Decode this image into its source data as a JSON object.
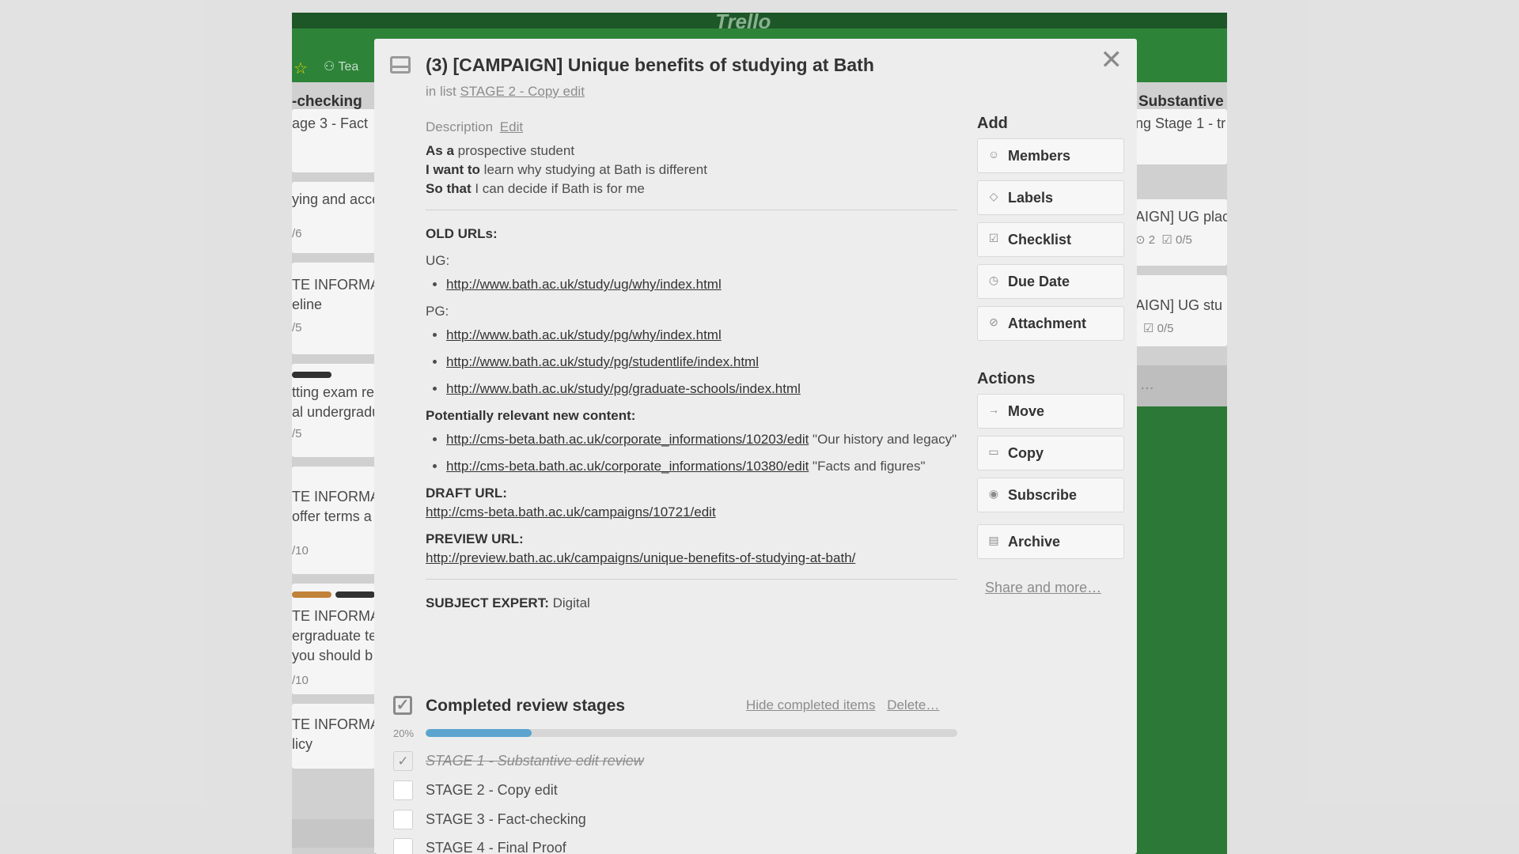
{
  "board": {
    "logo": "Trello",
    "team_label": "Tea",
    "left_list": {
      "title": "-checking",
      "cards": [
        "age 3 - Fact",
        "ying and acce",
        "/6",
        "TE INFORMA",
        "eline",
        "/5",
        "tting exam re",
        "al undergradu",
        "/5",
        "TE INFORMA",
        " offer terms a",
        "/10",
        "TE INFORMA",
        "ergraduate te",
        " you should b",
        "/10",
        "TE INFORMA",
        "licy"
      ]
    },
    "right_list": {
      "title": "Substantive e",
      "cards": [
        "ng Stage 1 - tr",
        "AIGN] UG plac",
        "2",
        "0/5",
        "AIGN] UG stu",
        "0/5",
        "…"
      ]
    }
  },
  "modal": {
    "title": "(3) [CAMPAIGN] Unique benefits of studying at Bath",
    "in_list_prefix": "in list",
    "list_name": "STAGE 2 - Copy edit",
    "description_label": "Description",
    "edit_label": "Edit",
    "story": [
      {
        "bold": "As a",
        "text": " prospective student"
      },
      {
        "bold": "I want to",
        "text": " learn why studying at Bath is different"
      },
      {
        "bold": "So that",
        "text": " I can decide if Bath is for me"
      }
    ],
    "old_urls_label": "OLD URLs:",
    "ug_label": "UG:",
    "ug_links": [
      "http://www.bath.ac.uk/study/ug/why/index.html"
    ],
    "pg_label": "PG:",
    "pg_links": [
      "http://www.bath.ac.uk/study/pg/why/index.html",
      "http://www.bath.ac.uk/study/pg/studentlife/index.html",
      "http://www.bath.ac.uk/study/pg/graduate-schools/index.html"
    ],
    "new_content_label": "Potentially relevant new content:",
    "new_content": [
      {
        "link": "http://cms-beta.bath.ac.uk/corporate_informations/10203/edit",
        "text": " \"Our history and legacy\""
      },
      {
        "link": "http://cms-beta.bath.ac.uk/corporate_informations/10380/edit",
        "text": " \"Facts and figures\""
      }
    ],
    "draft_label": "DRAFT URL:",
    "draft_url": "http://cms-beta.bath.ac.uk/campaigns/10721/edit",
    "preview_label": "PREVIEW URL:",
    "preview_url": "http://preview.bath.ac.uk/campaigns/unique-benefits-of-studying-at-bath/",
    "subject_expert_label": "SUBJECT EXPERT:",
    "subject_expert_value": " Digital",
    "checklist": {
      "title": "Completed review stages",
      "hide_label": "Hide completed items",
      "delete_label": "Delete…",
      "percent_label": "20%",
      "progress": 0.2,
      "items": [
        {
          "label": "STAGE 1 - Substantive edit review",
          "done": true
        },
        {
          "label": "STAGE 2 - Copy edit",
          "done": false
        },
        {
          "label": "STAGE 3 - Fact-checking",
          "done": false
        },
        {
          "label": "STAGE 4 - Final Proof",
          "done": false
        }
      ]
    },
    "sidebar": {
      "add_heading": "Add",
      "add_buttons": [
        "Members",
        "Labels",
        "Checklist",
        "Due Date",
        "Attachment"
      ],
      "actions_heading": "Actions",
      "action_buttons": [
        "Move",
        "Copy",
        "Subscribe"
      ],
      "archive_label": "Archive",
      "share_label": "Share and more…"
    },
    "colors": {
      "progress_fill": "#5ba4cf",
      "board_green": "#2e7d3a"
    },
    "icons": {
      "close": "close-icon",
      "card": "card-icon",
      "checklist": "checklist-icon"
    }
  }
}
